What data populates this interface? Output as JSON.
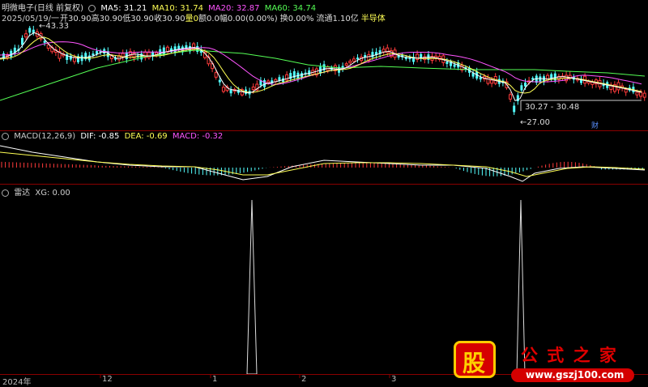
{
  "header": {
    "stock_title": "明微电子(日线 前复权)",
    "ma5": "MA5: 31.21",
    "ma10": "MA10: 31.74",
    "ma20": "MA20: 32.87",
    "ma60": "MA60: 34.74"
  },
  "info_line": {
    "date": "2025/05/19/一",
    "open": "开30.90",
    "high": "高30.90",
    "low": "低30.90",
    "close": "收30.90",
    "vol": "量0",
    "amount": "额0.0",
    "change": "幅0.00(0.00%)",
    "turnover": "换0.00%",
    "float_cap": "流通1.10亿",
    "sector": "半导体"
  },
  "price_annotations": {
    "high_label": "43.33",
    "low_label": "27.00",
    "range_label": "30.27 - 30.48",
    "fin_marker": "财"
  },
  "macd": {
    "title": "MACD(12,26,9)",
    "dif": "DIF: -0.85",
    "dea": "DEA: -0.69",
    "macd": "MACD: -0.32"
  },
  "radar": {
    "title": "雷达",
    "xg": "XG: 0.00"
  },
  "x_axis": {
    "labels": [
      "2024年",
      "12",
      "1",
      "2",
      "3"
    ]
  },
  "watermark": {
    "logo_char": "股",
    "brand": "公 式 之 家",
    "url": "www.gszj100.com"
  },
  "colors": {
    "up": "#ff3b3b",
    "down": "#54ffff",
    "ma5": "#ffffff",
    "ma10": "#ffff55",
    "ma20": "#ff55ff",
    "ma60": "#55ff55",
    "divider": "#8a0000"
  }
}
